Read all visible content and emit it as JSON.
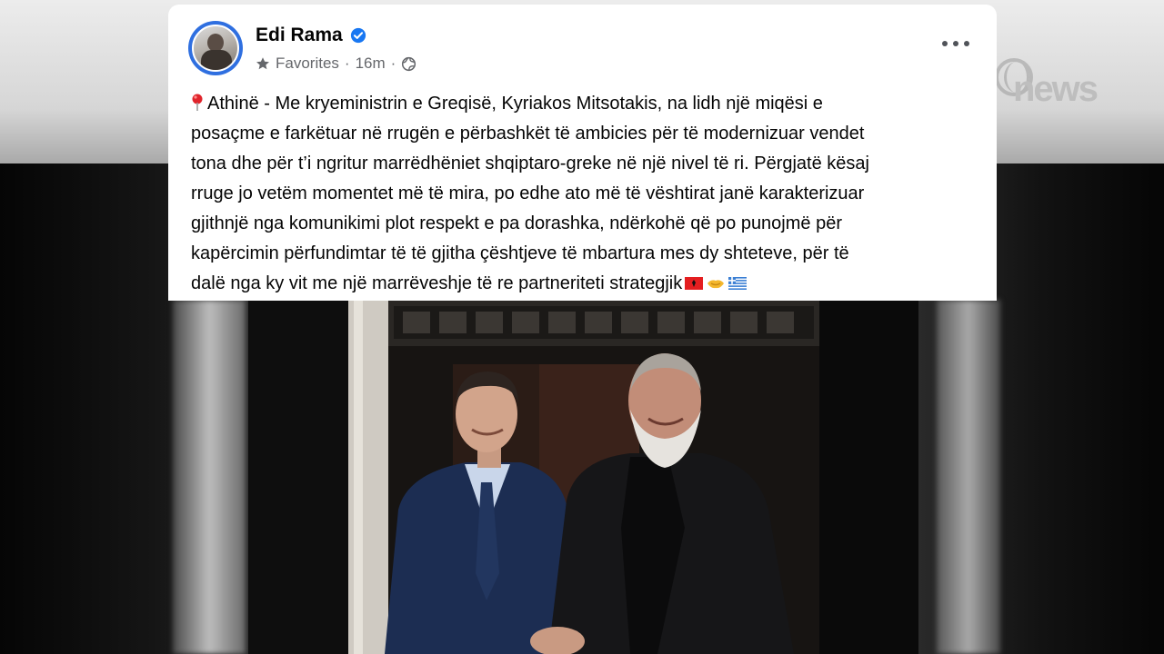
{
  "post": {
    "author": "Edi Rama",
    "audience": "Favorites",
    "time": "16m",
    "lines": [
      "Athinë - Me kryeministrin e Greqisë, Kyriakos Mitsotakis, na lidh një miqësi e",
      "posaçme e farkëtuar në rrugën e përbashkët të ambicies për të modernizuar vendet",
      "tona dhe për t’i ngritur marrëdhëniet shqiptaro-greke në një nivel të ri. Përgjatë kësaj",
      "rruge jo vetëm momentet më të mira, po edhe ato më të vështirat janë karakterizuar",
      "gjithnjë nga komunikimi plot respekt e pa dorashka, ndërkohë që po punojmë për",
      "kapërcimin përfundimtar të të gjitha çështjeve të mbartura mes dy shteteve, për të",
      "dalë nga ky vit me një marrëveshje të re partneriteti strategjik"
    ],
    "icons": {
      "verified": "verified-badge-icon",
      "audience": "star-icon",
      "privacy": "globe-icon",
      "menu": "more-options-icon",
      "location": "round-pushpin-icon",
      "trailing_emoji": [
        "albania-flag-icon",
        "handshake-icon",
        "greece-flag-icon"
      ]
    }
  },
  "watermark": {
    "text": "news"
  },
  "colors": {
    "verified": "#1877f2",
    "text": "#050505",
    "meta": "#65676b",
    "card": "#ffffff"
  }
}
